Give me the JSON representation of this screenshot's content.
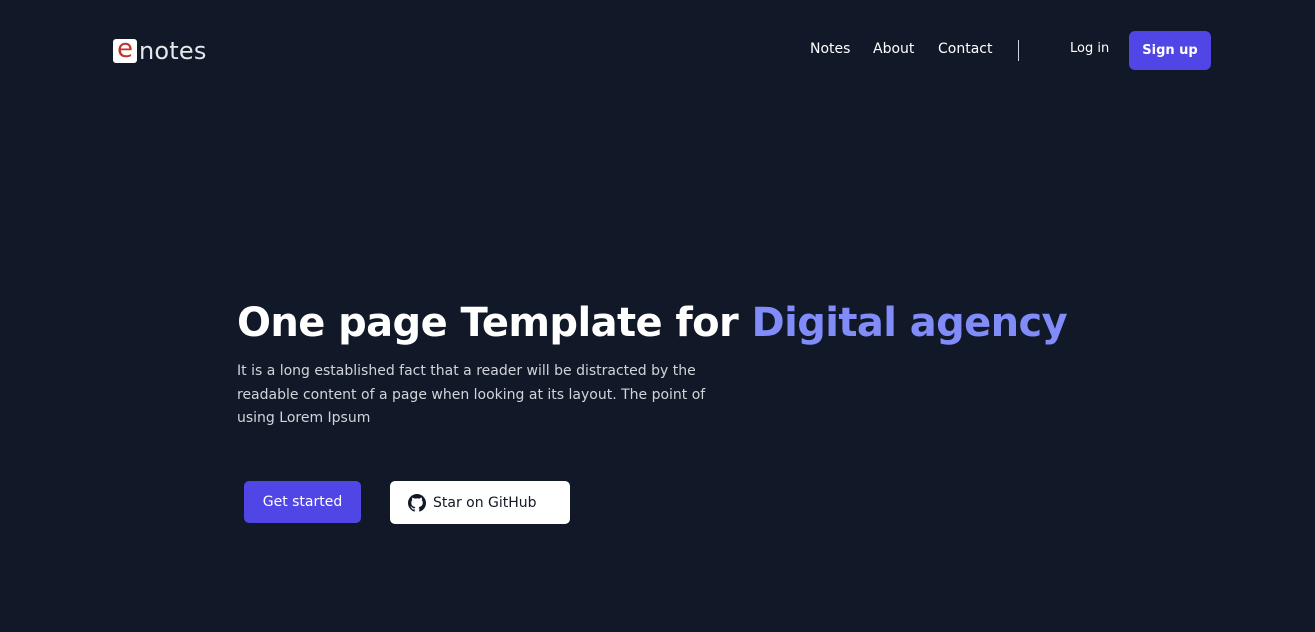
{
  "header": {
    "logo_mark": "e",
    "logo_text": "notes",
    "nav": [
      "Notes",
      "About",
      "Contact"
    ],
    "login_label": "Log in",
    "signup_label": "Sign up"
  },
  "hero": {
    "title_main": "One page Template for ",
    "title_accent": "Digital agency",
    "description": "It is a long established fact that a reader will be distracted by the readable content of a page when looking at its layout. The point of using Lorem Ipsum",
    "primary_button": "Get started",
    "github_button": "Star on GitHub",
    "github_icon": "github-icon"
  },
  "colors": {
    "background": "#111827",
    "accent": "#4f46e5",
    "accent_text": "#818cf8"
  }
}
